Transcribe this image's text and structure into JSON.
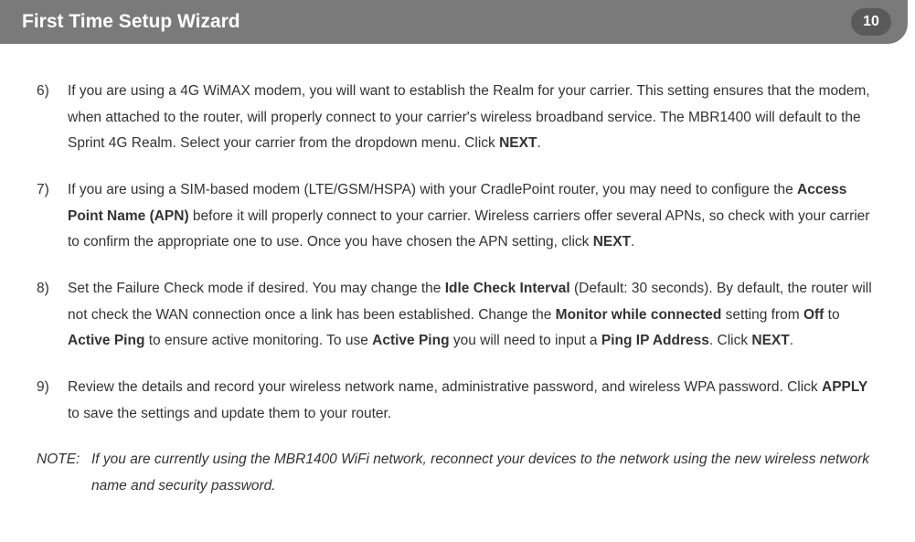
{
  "header": {
    "title": "First Time Setup Wizard",
    "page_number": "10"
  },
  "items": [
    {
      "num": "6)",
      "html": "If you are using a 4G WiMAX modem, you will want to establish the Realm for your carrier. This setting ensures that the modem, when attached to the router, will properly connect to your carrier's wireless broadband service. The MBR1400 will default to the Sprint 4G Realm. Select your carrier from the dropdown menu. Click <b>NEXT</b>."
    },
    {
      "num": "7)",
      "html": "If you are using a SIM-based modem (LTE/GSM/HSPA) with your CradlePoint router, you may need to configure the <b>Access Point Name (APN)</b> before it will properly connect to your carrier. Wireless carriers offer several APNs, so check with your carrier to confirm the appropriate one to use. Once you have chosen the APN setting, click <b>NEXT</b>."
    },
    {
      "num": "8)",
      "html": "Set the Failure Check mode if desired. You may change the <b>Idle Check Interval</b> (Default: 30 seconds). By default, the router will not check the WAN connection once a link has been established. Change the <b>Monitor while connected</b> setting from <b>Off</b> to <b>Active Ping</b> to ensure active monitoring. To use <b>Active Ping</b> you will need to input a <b>Ping IP Address</b>. Click <b>NEXT</b>."
    },
    {
      "num": "9)",
      "html": "Review the details and record your wireless network name, administrative password, and wireless WPA password. Click <b>APPLY</b> to save the settings and update them to your router."
    }
  ],
  "note": {
    "label": "NOTE:",
    "html": "If you are currently using the MBR1400 WiFi network, reconnect your devices to the network using the new wireless network name and security password."
  }
}
